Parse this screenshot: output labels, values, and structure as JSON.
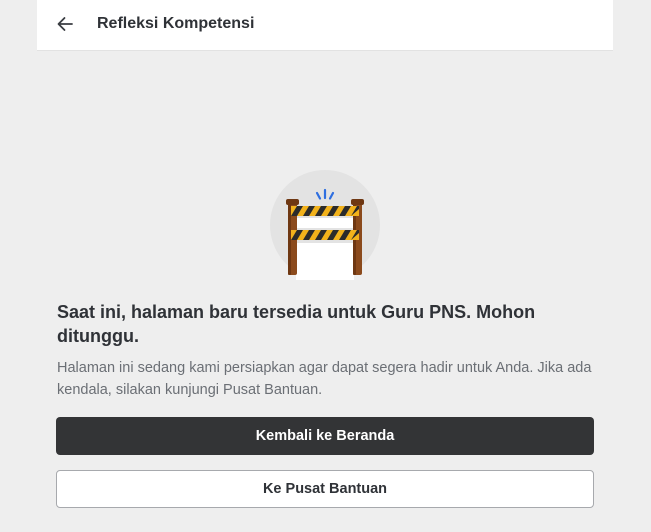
{
  "header": {
    "title": "Refleksi Kompetensi",
    "back_icon": "arrow-left-icon"
  },
  "illustration": {
    "icon": "construction-barrier-icon"
  },
  "message": {
    "headline": "Saat ini, halaman baru tersedia untuk Guru PNS. Mohon ditunggu.",
    "description": "Halaman ini sedang kami persiapkan agar dapat segera hadir untuk Anda. Jika ada kendala, silakan kunjungi Pusat Bantuan."
  },
  "actions": {
    "primary_label": "Kembali ke Beranda",
    "secondary_label": "Ke Pusat Bantuan"
  },
  "colors": {
    "page_background": "#eeeeee",
    "primary_button": "#333436",
    "barrier_wood": "#8b4a1c",
    "barrier_stripe": "#f2b21b"
  }
}
